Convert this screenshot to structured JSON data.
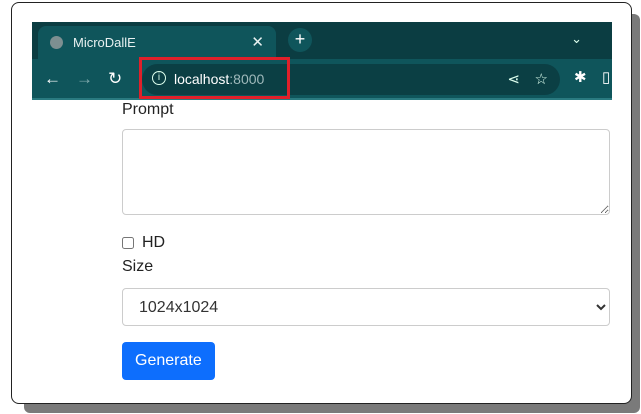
{
  "browser": {
    "tab_title": "MicroDallE",
    "url_host": "localhost",
    "url_port": ":8000"
  },
  "form": {
    "prompt_label": "Prompt",
    "prompt_value": "",
    "hd_label": "HD",
    "hd_checked": false,
    "size_label": "Size",
    "size_value": "1024x1024",
    "generate_label": "Generate"
  },
  "colors": {
    "highlight": "#e0202a",
    "button": "#0d6efd"
  }
}
